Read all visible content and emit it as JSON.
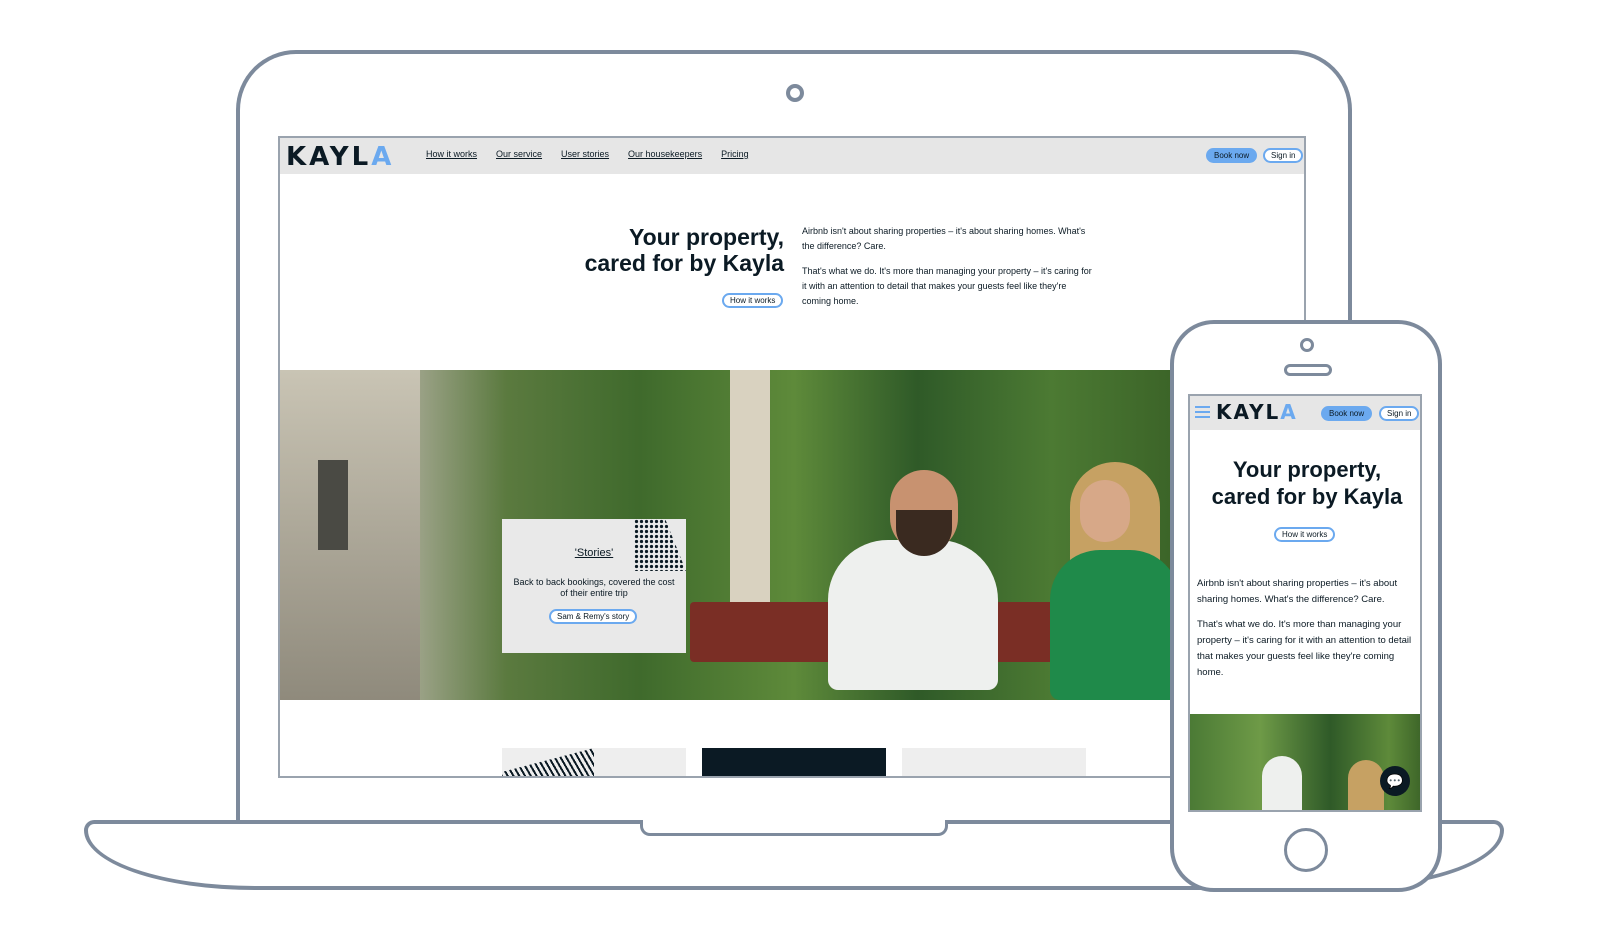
{
  "brand": {
    "logo_text_main": "KAYL",
    "logo_text_accent": "A",
    "accent_color": "#6ba9ef",
    "ink_color": "#0b1a24"
  },
  "desktop": {
    "nav": {
      "links": [
        "How it works",
        "Our service",
        "User stories",
        "Our housekeepers",
        "Pricing"
      ],
      "book_label": "Book now",
      "signin_label": "Sign in"
    },
    "hero": {
      "title_line1": "Your property,",
      "title_line2": "cared for by Kayla",
      "cta_label": "How it works",
      "para1": "Airbnb isn't about sharing properties – it's about sharing homes. What's the difference? Care.",
      "para2": "That's what we do. It's more than managing your property – it's caring for it with an attention to detail that makes your guests feel like they're coming home."
    },
    "story_card": {
      "title": "'Stories'",
      "text": "Back to back bookings, covered the cost of their entire trip",
      "button_label": "Sam & Remy's story"
    }
  },
  "mobile": {
    "nav": {
      "book_label": "Book now",
      "signin_label": "Sign in"
    },
    "hero": {
      "title_line1": "Your property,",
      "title_line2": "cared for by Kayla",
      "cta_label": "How it works",
      "para1": "Airbnb isn't about sharing properties – it's about sharing homes. What's the difference? Care.",
      "para2": "That's what we do. It's more than managing your property – it's caring for it with an attention to detail that makes your guests feel like they're coming home."
    },
    "chat_icon": "chat-icon"
  }
}
